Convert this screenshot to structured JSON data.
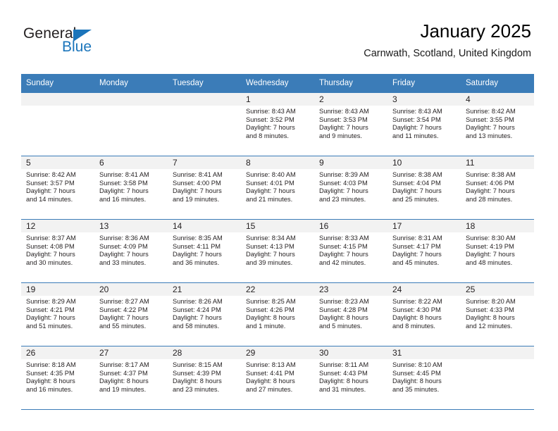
{
  "brand": {
    "name_top": "General",
    "name_bottom": "Blue",
    "accent_color": "#1b75bb"
  },
  "header": {
    "title": "January 2025",
    "subtitle": "Carnwath, Scotland, United Kingdom"
  },
  "theme": {
    "header_row_bg": "#3b7cb8",
    "daynum_bg": "#f2f2f2",
    "grid_line": "#3b7cb8",
    "text": "#231f20"
  },
  "weekday_headers": [
    "Sunday",
    "Monday",
    "Tuesday",
    "Wednesday",
    "Thursday",
    "Friday",
    "Saturday"
  ],
  "weeks": [
    [
      {
        "day": "",
        "sunrise": "",
        "sunset": "",
        "daylight_line1": "",
        "daylight_line2": ""
      },
      {
        "day": "",
        "sunrise": "",
        "sunset": "",
        "daylight_line1": "",
        "daylight_line2": ""
      },
      {
        "day": "",
        "sunrise": "",
        "sunset": "",
        "daylight_line1": "",
        "daylight_line2": ""
      },
      {
        "day": "1",
        "sunrise": "Sunrise: 8:43 AM",
        "sunset": "Sunset: 3:52 PM",
        "daylight_line1": "Daylight: 7 hours",
        "daylight_line2": "and 8 minutes."
      },
      {
        "day": "2",
        "sunrise": "Sunrise: 8:43 AM",
        "sunset": "Sunset: 3:53 PM",
        "daylight_line1": "Daylight: 7 hours",
        "daylight_line2": "and 9 minutes."
      },
      {
        "day": "3",
        "sunrise": "Sunrise: 8:43 AM",
        "sunset": "Sunset: 3:54 PM",
        "daylight_line1": "Daylight: 7 hours",
        "daylight_line2": "and 11 minutes."
      },
      {
        "day": "4",
        "sunrise": "Sunrise: 8:42 AM",
        "sunset": "Sunset: 3:55 PM",
        "daylight_line1": "Daylight: 7 hours",
        "daylight_line2": "and 13 minutes."
      }
    ],
    [
      {
        "day": "5",
        "sunrise": "Sunrise: 8:42 AM",
        "sunset": "Sunset: 3:57 PM",
        "daylight_line1": "Daylight: 7 hours",
        "daylight_line2": "and 14 minutes."
      },
      {
        "day": "6",
        "sunrise": "Sunrise: 8:41 AM",
        "sunset": "Sunset: 3:58 PM",
        "daylight_line1": "Daylight: 7 hours",
        "daylight_line2": "and 16 minutes."
      },
      {
        "day": "7",
        "sunrise": "Sunrise: 8:41 AM",
        "sunset": "Sunset: 4:00 PM",
        "daylight_line1": "Daylight: 7 hours",
        "daylight_line2": "and 19 minutes."
      },
      {
        "day": "8",
        "sunrise": "Sunrise: 8:40 AM",
        "sunset": "Sunset: 4:01 PM",
        "daylight_line1": "Daylight: 7 hours",
        "daylight_line2": "and 21 minutes."
      },
      {
        "day": "9",
        "sunrise": "Sunrise: 8:39 AM",
        "sunset": "Sunset: 4:03 PM",
        "daylight_line1": "Daylight: 7 hours",
        "daylight_line2": "and 23 minutes."
      },
      {
        "day": "10",
        "sunrise": "Sunrise: 8:38 AM",
        "sunset": "Sunset: 4:04 PM",
        "daylight_line1": "Daylight: 7 hours",
        "daylight_line2": "and 25 minutes."
      },
      {
        "day": "11",
        "sunrise": "Sunrise: 8:38 AM",
        "sunset": "Sunset: 4:06 PM",
        "daylight_line1": "Daylight: 7 hours",
        "daylight_line2": "and 28 minutes."
      }
    ],
    [
      {
        "day": "12",
        "sunrise": "Sunrise: 8:37 AM",
        "sunset": "Sunset: 4:08 PM",
        "daylight_line1": "Daylight: 7 hours",
        "daylight_line2": "and 30 minutes."
      },
      {
        "day": "13",
        "sunrise": "Sunrise: 8:36 AM",
        "sunset": "Sunset: 4:09 PM",
        "daylight_line1": "Daylight: 7 hours",
        "daylight_line2": "and 33 minutes."
      },
      {
        "day": "14",
        "sunrise": "Sunrise: 8:35 AM",
        "sunset": "Sunset: 4:11 PM",
        "daylight_line1": "Daylight: 7 hours",
        "daylight_line2": "and 36 minutes."
      },
      {
        "day": "15",
        "sunrise": "Sunrise: 8:34 AM",
        "sunset": "Sunset: 4:13 PM",
        "daylight_line1": "Daylight: 7 hours",
        "daylight_line2": "and 39 minutes."
      },
      {
        "day": "16",
        "sunrise": "Sunrise: 8:33 AM",
        "sunset": "Sunset: 4:15 PM",
        "daylight_line1": "Daylight: 7 hours",
        "daylight_line2": "and 42 minutes."
      },
      {
        "day": "17",
        "sunrise": "Sunrise: 8:31 AM",
        "sunset": "Sunset: 4:17 PM",
        "daylight_line1": "Daylight: 7 hours",
        "daylight_line2": "and 45 minutes."
      },
      {
        "day": "18",
        "sunrise": "Sunrise: 8:30 AM",
        "sunset": "Sunset: 4:19 PM",
        "daylight_line1": "Daylight: 7 hours",
        "daylight_line2": "and 48 minutes."
      }
    ],
    [
      {
        "day": "19",
        "sunrise": "Sunrise: 8:29 AM",
        "sunset": "Sunset: 4:21 PM",
        "daylight_line1": "Daylight: 7 hours",
        "daylight_line2": "and 51 minutes."
      },
      {
        "day": "20",
        "sunrise": "Sunrise: 8:27 AM",
        "sunset": "Sunset: 4:22 PM",
        "daylight_line1": "Daylight: 7 hours",
        "daylight_line2": "and 55 minutes."
      },
      {
        "day": "21",
        "sunrise": "Sunrise: 8:26 AM",
        "sunset": "Sunset: 4:24 PM",
        "daylight_line1": "Daylight: 7 hours",
        "daylight_line2": "and 58 minutes."
      },
      {
        "day": "22",
        "sunrise": "Sunrise: 8:25 AM",
        "sunset": "Sunset: 4:26 PM",
        "daylight_line1": "Daylight: 8 hours",
        "daylight_line2": "and 1 minute."
      },
      {
        "day": "23",
        "sunrise": "Sunrise: 8:23 AM",
        "sunset": "Sunset: 4:28 PM",
        "daylight_line1": "Daylight: 8 hours",
        "daylight_line2": "and 5 minutes."
      },
      {
        "day": "24",
        "sunrise": "Sunrise: 8:22 AM",
        "sunset": "Sunset: 4:30 PM",
        "daylight_line1": "Daylight: 8 hours",
        "daylight_line2": "and 8 minutes."
      },
      {
        "day": "25",
        "sunrise": "Sunrise: 8:20 AM",
        "sunset": "Sunset: 4:33 PM",
        "daylight_line1": "Daylight: 8 hours",
        "daylight_line2": "and 12 minutes."
      }
    ],
    [
      {
        "day": "26",
        "sunrise": "Sunrise: 8:18 AM",
        "sunset": "Sunset: 4:35 PM",
        "daylight_line1": "Daylight: 8 hours",
        "daylight_line2": "and 16 minutes."
      },
      {
        "day": "27",
        "sunrise": "Sunrise: 8:17 AM",
        "sunset": "Sunset: 4:37 PM",
        "daylight_line1": "Daylight: 8 hours",
        "daylight_line2": "and 19 minutes."
      },
      {
        "day": "28",
        "sunrise": "Sunrise: 8:15 AM",
        "sunset": "Sunset: 4:39 PM",
        "daylight_line1": "Daylight: 8 hours",
        "daylight_line2": "and 23 minutes."
      },
      {
        "day": "29",
        "sunrise": "Sunrise: 8:13 AM",
        "sunset": "Sunset: 4:41 PM",
        "daylight_line1": "Daylight: 8 hours",
        "daylight_line2": "and 27 minutes."
      },
      {
        "day": "30",
        "sunrise": "Sunrise: 8:11 AM",
        "sunset": "Sunset: 4:43 PM",
        "daylight_line1": "Daylight: 8 hours",
        "daylight_line2": "and 31 minutes."
      },
      {
        "day": "31",
        "sunrise": "Sunrise: 8:10 AM",
        "sunset": "Sunset: 4:45 PM",
        "daylight_line1": "Daylight: 8 hours",
        "daylight_line2": "and 35 minutes."
      },
      {
        "day": "",
        "sunrise": "",
        "sunset": "",
        "daylight_line1": "",
        "daylight_line2": ""
      }
    ]
  ]
}
